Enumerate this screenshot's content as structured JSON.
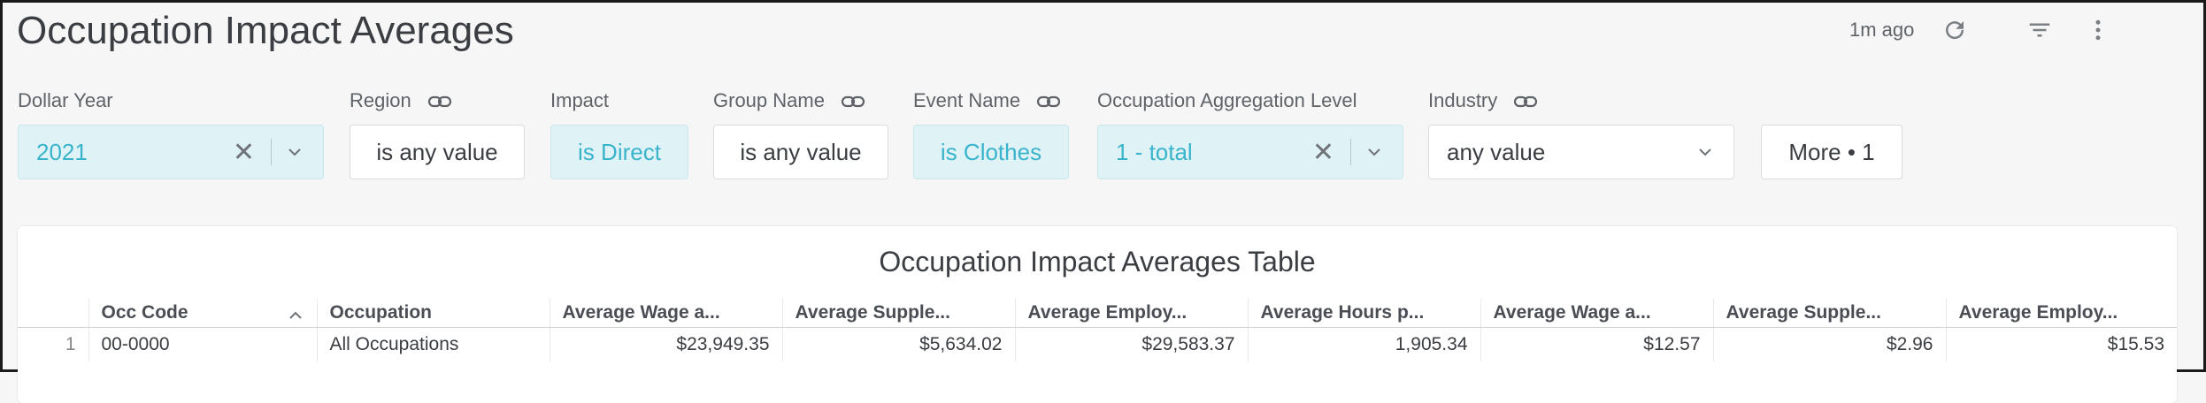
{
  "page_title": "Occupation Impact Averages",
  "header": {
    "updated": "1m ago",
    "icons": [
      "refresh-icon",
      "filter-icon",
      "more-vertical-icon"
    ]
  },
  "filters": [
    {
      "label": "Dollar Year",
      "value": "2021",
      "active": true,
      "clearable": true,
      "dropdown": true,
      "link_icon": false
    },
    {
      "label": "Region",
      "value": "is any value",
      "active": false,
      "clearable": false,
      "dropdown": false,
      "link_icon": true
    },
    {
      "label": "Impact",
      "value": "is Direct",
      "active": true,
      "clearable": false,
      "dropdown": false,
      "link_icon": false
    },
    {
      "label": "Group Name",
      "value": "is any value",
      "active": false,
      "clearable": false,
      "dropdown": false,
      "link_icon": true
    },
    {
      "label": "Event Name",
      "value": "is Clothes",
      "active": true,
      "clearable": false,
      "dropdown": false,
      "link_icon": true
    },
    {
      "label": "Occupation Aggregation Level",
      "value": "1 - total",
      "active": true,
      "clearable": true,
      "dropdown": true,
      "link_icon": false
    },
    {
      "label": "Industry",
      "value": "any value",
      "active": false,
      "clearable": false,
      "dropdown": true,
      "link_icon": true
    }
  ],
  "more_button": "More • 1",
  "table": {
    "title": "Occupation Impact Averages Table",
    "columns": [
      "Occ Code",
      "Occupation",
      "Average Wage a...",
      "Average Supple...",
      "Average Employ...",
      "Average Hours p...",
      "Average Wage a...",
      "Average Supple...",
      "Average Employ..."
    ],
    "rows": [
      {
        "index": "1",
        "cells": [
          "00-0000",
          "All Occupations",
          "$23,949.35",
          "$5,634.02",
          "$29,583.37",
          "1,905.34",
          "$12.57",
          "$2.96",
          "$15.53"
        ]
      }
    ]
  }
}
